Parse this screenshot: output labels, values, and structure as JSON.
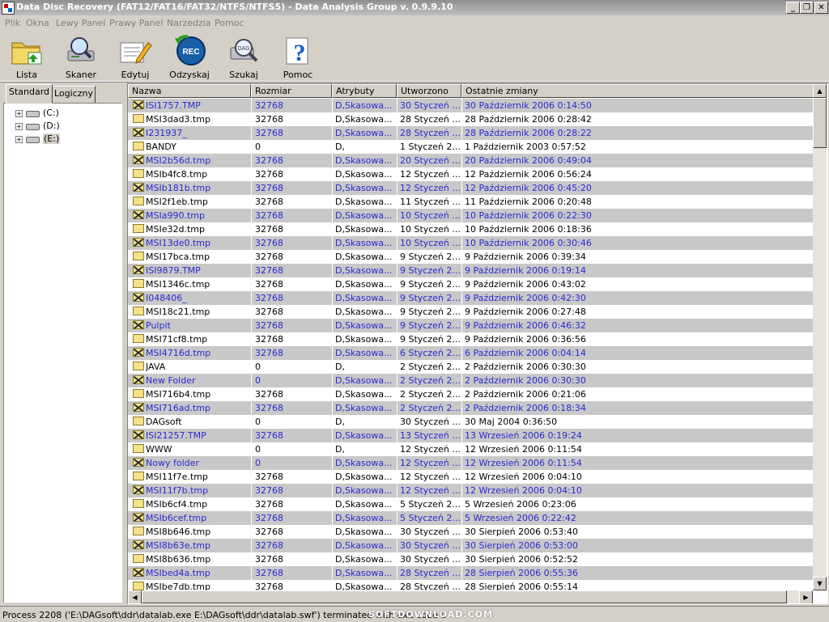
{
  "window": {
    "title": "Data Disc Recovery (FAT12/FAT16/FAT32/NTFS/NTFS5) - Data Analysis Group v. 0.9.9.10"
  },
  "menu": [
    "Plik",
    "Okna",
    "Lewy Panel",
    "Prawy Panel",
    "Narzedzia",
    "Pomoc"
  ],
  "toolbar": [
    {
      "label": "Lista",
      "icon": "folder-list-icon"
    },
    {
      "label": "Skaner",
      "icon": "disk-scanner-icon"
    },
    {
      "label": "Edytuj",
      "icon": "edit-pencil-icon"
    },
    {
      "label": "Odzyskaj",
      "icon": "rec-recover-icon"
    },
    {
      "label": "Szukaj",
      "icon": "search-magnifier-icon"
    },
    {
      "label": "Pomoc",
      "icon": "help-question-icon"
    }
  ],
  "left_panel": {
    "tabs": [
      "Standard",
      "Logiczny"
    ],
    "drives": [
      "(C:)",
      "(D:)",
      "(E:)"
    ]
  },
  "table": {
    "columns": [
      "Nazwa",
      "Rozmiar",
      "Atrybuty",
      "Utworzono",
      "Ostatnie zmiany"
    ],
    "rows": [
      {
        "name": "ISI1757.TMP",
        "size": "32768",
        "attr": "D,Skasowa...",
        "created": "30 Styczeń ...",
        "modified": "30 Październik 2006 0:14:50",
        "deleted": true
      },
      {
        "name": "MSI3dad3.tmp",
        "size": "32768",
        "attr": "D,Skasowa...",
        "created": "28 Styczeń ...",
        "modified": "28 Październik 2006 0:28:42",
        "deleted": false
      },
      {
        "name": "I231937_",
        "size": "32768",
        "attr": "D,Skasowa...",
        "created": "28 Styczeń ...",
        "modified": "28 Październik 2006 0:28:22",
        "deleted": true
      },
      {
        "name": "BANDY",
        "size": "0",
        "attr": "D,",
        "created": "1 Styczeń 2...",
        "modified": "1 Październik 2003 0:57:52",
        "deleted": false
      },
      {
        "name": "MSI2b56d.tmp",
        "size": "32768",
        "attr": "D,Skasowa...",
        "created": "20 Styczeń ...",
        "modified": "20 Październik 2006 0:49:04",
        "deleted": true
      },
      {
        "name": "MSIb4fc8.tmp",
        "size": "32768",
        "attr": "D,Skasowa...",
        "created": "12 Styczeń ...",
        "modified": "12 Październik 2006 0:56:24",
        "deleted": false
      },
      {
        "name": "MSIb181b.tmp",
        "size": "32768",
        "attr": "D,Skasowa...",
        "created": "12 Styczeń ...",
        "modified": "12 Październik 2006 0:45:20",
        "deleted": true
      },
      {
        "name": "MSI2f1eb.tmp",
        "size": "32768",
        "attr": "D,Skasowa...",
        "created": "11 Styczeń ...",
        "modified": "11 Październik 2006 0:20:48",
        "deleted": false
      },
      {
        "name": "MSIa990.tmp",
        "size": "32768",
        "attr": "D,Skasowa...",
        "created": "10 Styczeń ...",
        "modified": "10 Październik 2006 0:22:30",
        "deleted": true
      },
      {
        "name": "MSIe32d.tmp",
        "size": "32768",
        "attr": "D,Skasowa...",
        "created": "10 Styczeń ...",
        "modified": "10 Październik 2006 0:18:36",
        "deleted": false
      },
      {
        "name": "MSI13de0.tmp",
        "size": "32768",
        "attr": "D,Skasowa...",
        "created": "10 Styczeń ...",
        "modified": "10 Październik 2006 0:30:46",
        "deleted": true
      },
      {
        "name": "MSI17bca.tmp",
        "size": "32768",
        "attr": "D,Skasowa...",
        "created": "9 Styczeń 2...",
        "modified": "9 Październik 2006 0:39:34",
        "deleted": false
      },
      {
        "name": "ISI9879.TMP",
        "size": "32768",
        "attr": "D,Skasowa...",
        "created": "9 Styczeń 2...",
        "modified": "9 Październik 2006 0:19:14",
        "deleted": true
      },
      {
        "name": "MSI1346c.tmp",
        "size": "32768",
        "attr": "D,Skasowa...",
        "created": "9 Styczeń 2...",
        "modified": "9 Październik 2006 0:43:02",
        "deleted": false
      },
      {
        "name": "I048406_",
        "size": "32768",
        "attr": "D,Skasowa...",
        "created": "9 Styczeń 2...",
        "modified": "9 Październik 2006 0:42:30",
        "deleted": true
      },
      {
        "name": "MSI18c21.tmp",
        "size": "32768",
        "attr": "D,Skasowa...",
        "created": "9 Styczeń 2...",
        "modified": "9 Październik 2006 0:27:48",
        "deleted": false
      },
      {
        "name": "Pulpit",
        "size": "32768",
        "attr": "D,Skasowa...",
        "created": "9 Styczeń 2...",
        "modified": "9 Październik 2006 0:46:32",
        "deleted": true
      },
      {
        "name": "MSI71cf8.tmp",
        "size": "32768",
        "attr": "D,Skasowa...",
        "created": "9 Styczeń 2...",
        "modified": "9 Październik 2006 0:36:56",
        "deleted": false
      },
      {
        "name": "MSI4716d.tmp",
        "size": "32768",
        "attr": "D,Skasowa...",
        "created": "6 Styczeń 2...",
        "modified": "6 Październik 2006 0:04:14",
        "deleted": true
      },
      {
        "name": "JAVA",
        "size": "0",
        "attr": "D,",
        "created": "2 Styczeń 2...",
        "modified": "2 Październik 2006 0:30:30",
        "deleted": false
      },
      {
        "name": "New Folder",
        "size": "0",
        "attr": "D,Skasowa...",
        "created": "2 Styczeń 2...",
        "modified": "2 Październik 2006 0:30:30",
        "deleted": true
      },
      {
        "name": "MSI716b4.tmp",
        "size": "32768",
        "attr": "D,Skasowa...",
        "created": "2 Styczeń 2...",
        "modified": "2 Październik 2006 0:21:06",
        "deleted": false
      },
      {
        "name": "MSI716ad.tmp",
        "size": "32768",
        "attr": "D,Skasowa...",
        "created": "2 Styczeń 2...",
        "modified": "2 Październik 2006 0:18:34",
        "deleted": true
      },
      {
        "name": "DAGsoft",
        "size": "0",
        "attr": "D,",
        "created": "30 Styczeń ...",
        "modified": "30 Maj 2004 0:36:50",
        "deleted": false
      },
      {
        "name": "ISI21257.TMP",
        "size": "32768",
        "attr": "D,Skasowa...",
        "created": "13 Styczeń ...",
        "modified": "13 Wrzesień 2006 0:19:24",
        "deleted": true
      },
      {
        "name": "WWW",
        "size": "0",
        "attr": "D,",
        "created": "12 Styczeń ...",
        "modified": "12 Wrzesień 2006 0:11:54",
        "deleted": false
      },
      {
        "name": "Nowy folder",
        "size": "0",
        "attr": "D,Skasowa...",
        "created": "12 Styczeń ...",
        "modified": "12 Wrzesień 2006 0:11:54",
        "deleted": true
      },
      {
        "name": "MSI11f7e.tmp",
        "size": "32768",
        "attr": "D,Skasowa...",
        "created": "12 Styczeń ...",
        "modified": "12 Wrzesień 2006 0:04:10",
        "deleted": false
      },
      {
        "name": "MSI11f7b.tmp",
        "size": "32768",
        "attr": "D,Skasowa...",
        "created": "12 Styczeń ...",
        "modified": "12 Wrzesień 2006 0:04:10",
        "deleted": true
      },
      {
        "name": "MSIb6cf4.tmp",
        "size": "32768",
        "attr": "D,Skasowa...",
        "created": "5 Styczeń 2...",
        "modified": "5 Wrzesień 2006 0:23:06",
        "deleted": false
      },
      {
        "name": "MSIb6cef.tmp",
        "size": "32768",
        "attr": "D,Skasowa...",
        "created": "5 Styczeń 2...",
        "modified": "5 Wrzesień 2006 0:22:42",
        "deleted": true
      },
      {
        "name": "MSI8b646.tmp",
        "size": "32768",
        "attr": "D,Skasowa...",
        "created": "30 Styczeń ...",
        "modified": "30 Sierpień 2006 0:53:40",
        "deleted": false
      },
      {
        "name": "MSI8b63e.tmp",
        "size": "32768",
        "attr": "D,Skasowa...",
        "created": "30 Styczeń ...",
        "modified": "30 Sierpień 2006 0:53:00",
        "deleted": true
      },
      {
        "name": "MSI8b636.tmp",
        "size": "32768",
        "attr": "D,Skasowa...",
        "created": "30 Styczeń ...",
        "modified": "30 Sierpień 2006 0:52:52",
        "deleted": false
      },
      {
        "name": "MSIbed4a.tmp",
        "size": "32768",
        "attr": "D,Skasowa...",
        "created": "28 Styczeń ...",
        "modified": "28 Sierpień 2006 0:55:36",
        "deleted": true
      },
      {
        "name": "MSIbe7db.tmp",
        "size": "32768",
        "attr": "D,Skasowa...",
        "created": "28 Styczeń ...",
        "modified": "28 Sierpień 2006 0:55:14",
        "deleted": false
      }
    ]
  },
  "status": {
    "text": "Process 2208 ('E:\\DAGsoft\\ddr\\datalab.exe E:\\DAGsoft\\ddr\\datalab.swf') terminated with exit code 0",
    "watermark": "SOFTDOWNLOAD.COM"
  },
  "colors": {
    "deleted_text": "#2a2ad0",
    "deleted_bg": "#c8c8c8",
    "window_bg": "#d4d0c8"
  }
}
